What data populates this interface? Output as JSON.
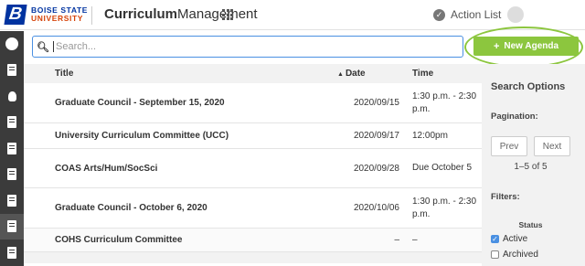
{
  "header": {
    "logo_line1": "BOISE STATE",
    "logo_line2": "UNIVERSITY",
    "logo_letter": "B",
    "app_title_bold": "Curriculum",
    "app_title_rest": "Management",
    "action_list": "Action List"
  },
  "rail": {
    "items": [
      "dashboard-icon",
      "document-icon",
      "lightbulb-icon",
      "document-icon",
      "document-icon",
      "document-icon",
      "buildings-icon",
      "list-icon",
      "document-icon"
    ],
    "active_index": 7
  },
  "search": {
    "placeholder": "Search...",
    "value": ""
  },
  "new_agenda": {
    "label": "New Agenda",
    "color": "#8cc63e"
  },
  "table": {
    "headers": {
      "title": "Title",
      "date": "Date",
      "time": "Time"
    },
    "rows": [
      {
        "title": "Graduate Council - September 15, 2020",
        "date": "2020/09/15",
        "time": "1:30 p.m. - 2:30 p.m."
      },
      {
        "title": "University Curriculum Committee (UCC)",
        "date": "2020/09/17",
        "time": "12:00pm"
      },
      {
        "title": "COAS Arts/Hum/SocSci",
        "date": "2020/09/28",
        "time": "Due October 5"
      },
      {
        "title": "Graduate Council - October 6, 2020",
        "date": "2020/10/06",
        "time": "1:30 p.m. - 2:30 p.m."
      },
      {
        "title": "COHS Curriculum Committee",
        "date": "–",
        "time": "–"
      }
    ]
  },
  "sidebar": {
    "title": "Search Options",
    "pagination_label": "Pagination:",
    "prev": "Prev",
    "next": "Next",
    "count": "1–5 of 5",
    "filters_label": "Filters:",
    "status_label": "Status",
    "active": "Active",
    "archived": "Archived",
    "active_checked": true,
    "archived_checked": false
  },
  "colors": {
    "brand_blue": "#0033a0",
    "brand_orange": "#d64309",
    "accent_green": "#8cc63e",
    "focus_blue": "#4a90e2"
  }
}
